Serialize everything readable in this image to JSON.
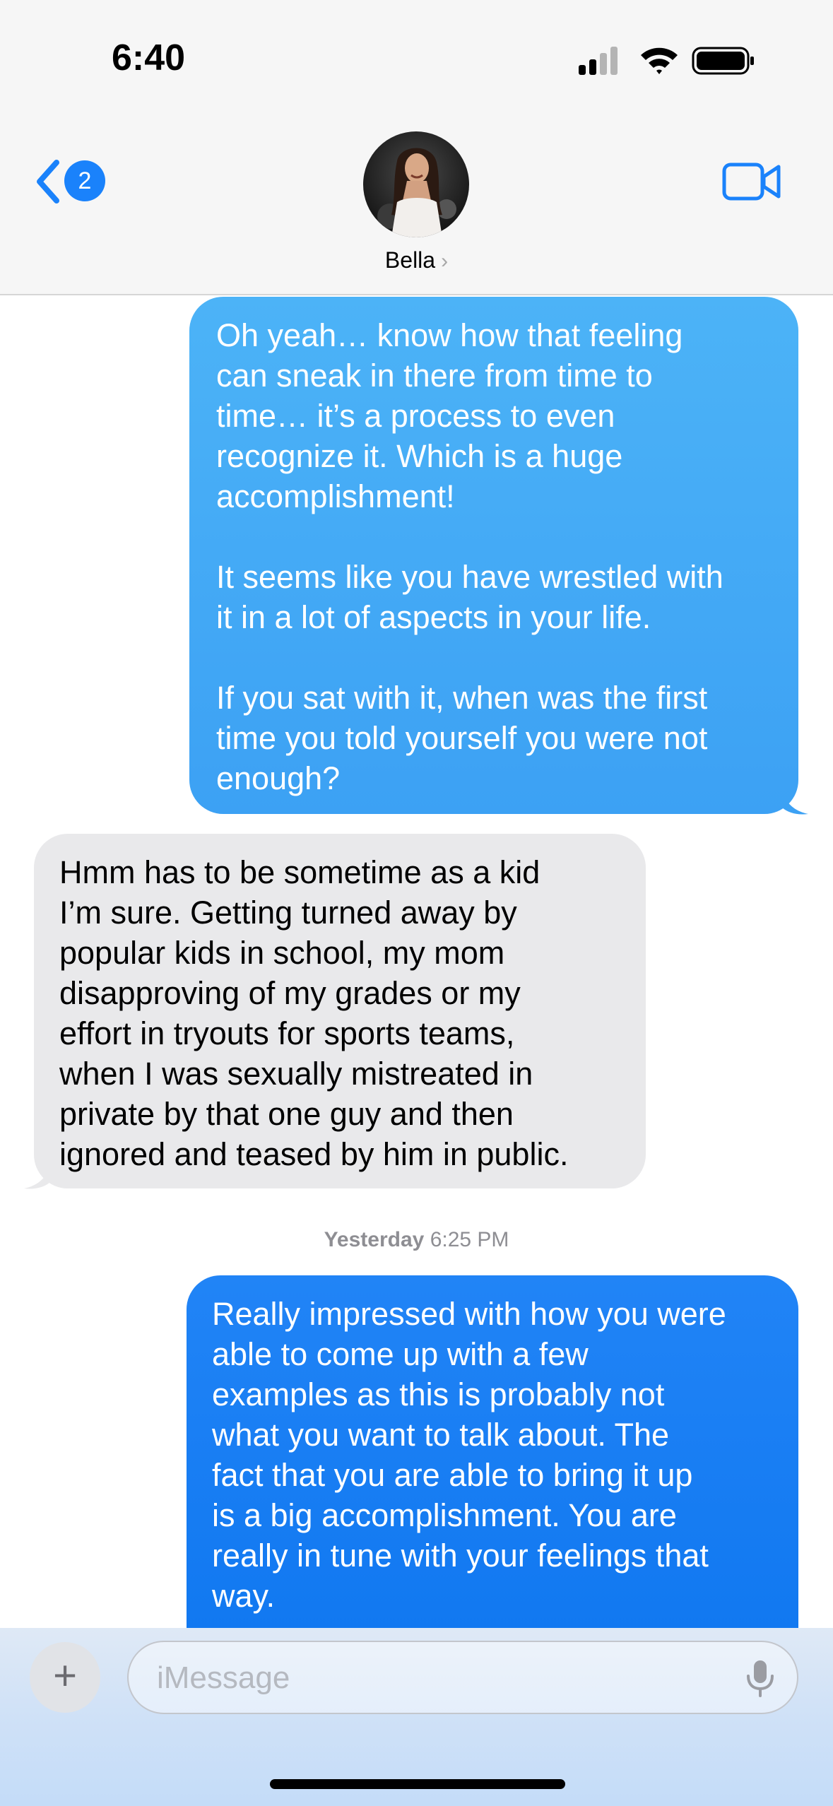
{
  "status_bar": {
    "time": "6:40",
    "icons": [
      "cellular-signal-icon",
      "wifi-icon",
      "battery-icon"
    ]
  },
  "header": {
    "back_badge_count": "2",
    "contact_name": "Bella",
    "chevron": "›",
    "video_call_icon": "video-camera-icon"
  },
  "conversation": {
    "messages": [
      {
        "direction": "outgoing",
        "text": "Oh yeah… know how that feeling\ncan sneak in there from time to\ntime… it’s a process to even\nrecognize it. Which is a huge\naccomplishment!\n\nIt seems like you have wrestled with\nit in a lot of aspects in your life.\n\nIf you sat with it, when was the first\ntime you told yourself you were not\nenough?"
      },
      {
        "direction": "incoming",
        "text": "Hmm has to be sometime as a kid\nI’m sure. Getting turned away by\npopular kids in school, my mom\ndisapproving of my grades or my\neffort in tryouts for sports teams,\nwhen I was sexually mistreated in\nprivate by that one guy and then\nignored and teased by him in public."
      },
      {
        "direction": "outgoing",
        "text": "Really impressed with how you were\nable to come up with a few\nexamples as this is probably not\nwhat you want to talk about. The\nfact that you are able to bring it up\nis a big accomplishment. You are\nreally in tune with your feelings that\nway."
      }
    ],
    "timestamp": {
      "day": "Yesterday",
      "time": "6:25 PM"
    }
  },
  "composer": {
    "plus_label": "+",
    "placeholder": "iMessage",
    "mic_icon": "microphone-icon"
  },
  "colors": {
    "accent": "#1a82fb",
    "outgoing_bubble_light": "#44aaf5",
    "outgoing_bubble_dark": "#1580f4",
    "incoming_bubble": "#e9e9eb",
    "header_bg": "#f6f6f6"
  }
}
